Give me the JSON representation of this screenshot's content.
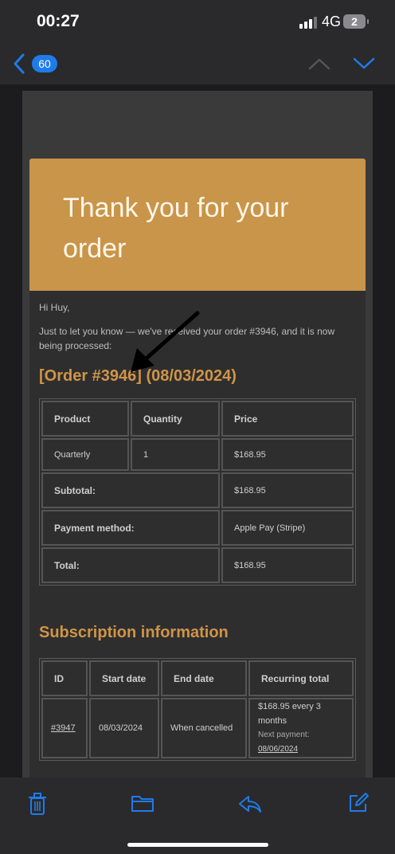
{
  "status_bar": {
    "time": "00:27",
    "network": "4G",
    "battery": "2"
  },
  "nav": {
    "unread_count": "60",
    "icons": [
      "chevron-left-icon",
      "chevron-up-icon",
      "chevron-down-icon"
    ]
  },
  "email": {
    "header_title": "Thank you for your order",
    "greeting": "Hi Huy,",
    "notice": "Just to let you know — we've received your order #3946, and it is now being processed:",
    "order_title": "[Order #3946] (08/03/2024)",
    "order_table": {
      "headers": [
        "Product",
        "Quantity",
        "Price"
      ],
      "item": {
        "product": "Quarterly",
        "quantity": "1",
        "price": "$168.95"
      },
      "totals": [
        {
          "label": "Subtotal:",
          "value": "$168.95"
        },
        {
          "label": "Payment method:",
          "value": "Apple Pay (Stripe)"
        },
        {
          "label": "Total:",
          "value": "$168.95"
        }
      ]
    },
    "subscription_title": "Subscription information",
    "subscription_table": {
      "headers": [
        "ID",
        "Start date",
        "End date",
        "Recurring total"
      ],
      "row": {
        "id": "#3947",
        "start": "08/03/2024",
        "end": "When cancelled",
        "recurring": "$168.95 every 3 months",
        "next_payment_label": "Next payment:",
        "next_payment_date": "08/06/2024"
      }
    }
  },
  "toolbar": {
    "icons": [
      "trash-icon",
      "folder-icon",
      "reply-icon",
      "compose-icon"
    ]
  },
  "colors": {
    "accent": "#c9954a",
    "title_orange": "#d09448",
    "ios_blue": "#1f7bea"
  }
}
